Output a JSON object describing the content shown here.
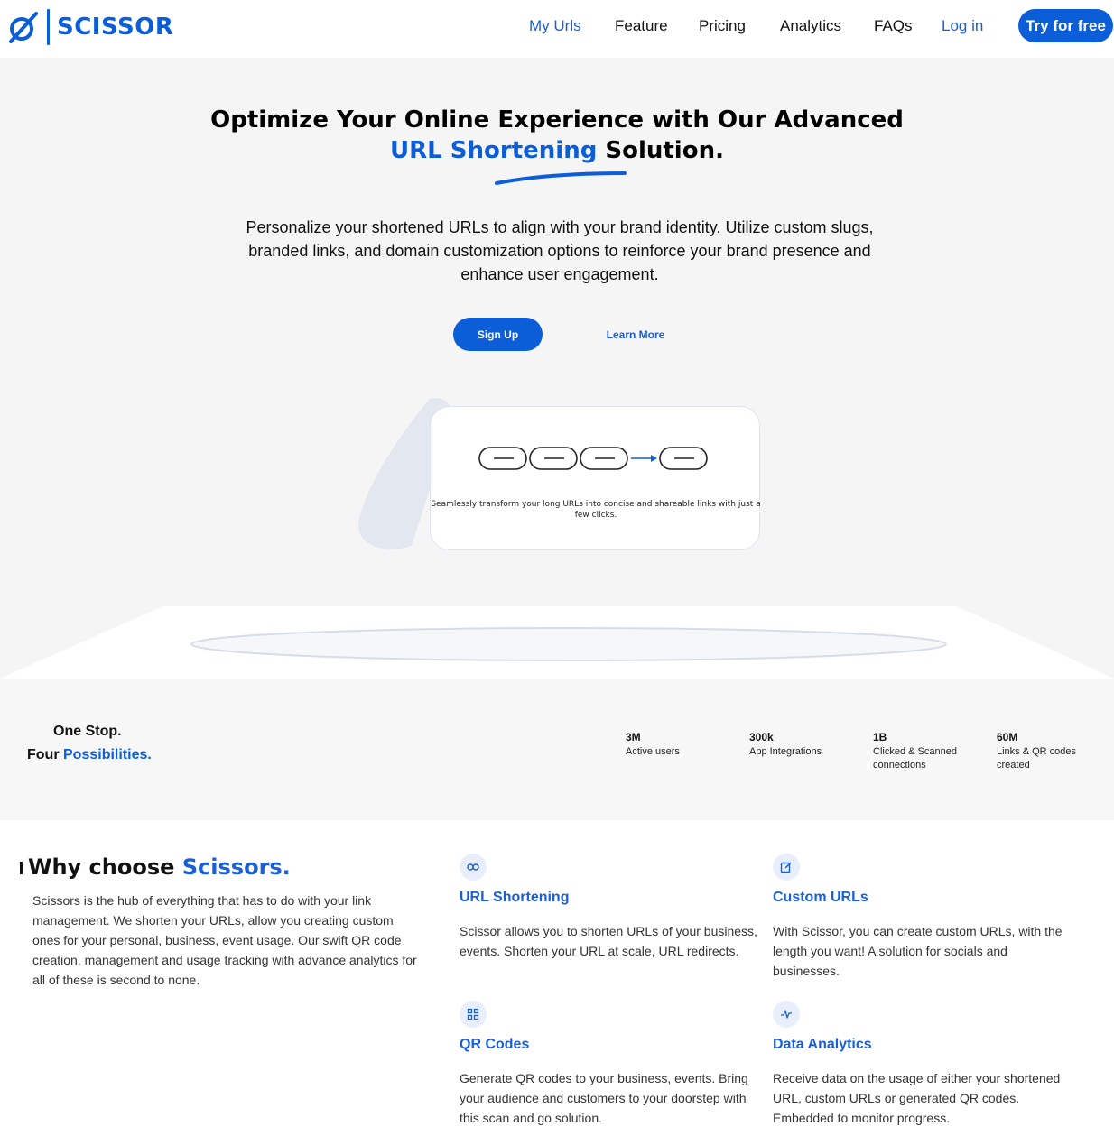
{
  "brand": {
    "name": "SCISSOR",
    "color": "#0b5ed7"
  },
  "nav": {
    "links": [
      {
        "label": "My Urls",
        "active": true
      },
      {
        "label": "Feature"
      },
      {
        "label": "Pricing"
      },
      {
        "label": "Analytics"
      },
      {
        "label": "FAQs"
      },
      {
        "label": "Log in",
        "active": true
      }
    ],
    "cta": "Try for free"
  },
  "hero": {
    "title_line1": "Optimize Your Online Experience with Our Advanced",
    "title_highlight": "URL Shortening",
    "title_end": " Solution.",
    "description": "Personalize your shortened URLs to align with your brand identity. Utilize custom slugs, branded links, and domain customization options to reinforce your brand presence and enhance user engagement.",
    "signup_label": "Sign Up",
    "learn_more_label": "Learn More",
    "card_caption": "Seamlessly transform your long URLs into concise and shareable links with just a few clicks."
  },
  "stats": {
    "heading_line1": "One Stop.",
    "heading_line2_plain": "Four ",
    "heading_line2_highlight": "Possibilities.",
    "items": [
      {
        "value": "3M",
        "label": "Active users"
      },
      {
        "value": "300k",
        "label": "App Integrations"
      },
      {
        "value": "1B",
        "label": "Clicked & Scanned connections"
      },
      {
        "value": "60M",
        "label": "Links & QR codes created"
      }
    ]
  },
  "why": {
    "title_plain": "Why choose ",
    "title_highlight": "Scissors.",
    "description": "Scissors is the hub of everything that has to do with your link management. We shorten your URLs, allow you creating custom ones for your personal, business, event usage. Our swift QR code creation, management and usage tracking with advance analytics for all of these is second to none.",
    "features": [
      {
        "icon": "link-icon",
        "title": "URL Shortening",
        "text": "Scissor allows you to shorten URLs of your business, events. Shorten your URL at scale, URL redirects."
      },
      {
        "icon": "edit-icon",
        "title": "Custom URLs",
        "text": "With Scissor, you can create custom URLs, with the length you want! A solution for socials and businesses."
      },
      {
        "icon": "qr-code-icon",
        "title": "QR Codes",
        "text": "Generate QR codes to your business, events. Bring your audience and customers to your doorstep with this scan and go solution."
      },
      {
        "icon": "activity-icon",
        "title": "Data Analytics",
        "text": "Receive data on the usage of either your shortened URL, custom URLs or generated QR codes. Embedded to monitor progress."
      }
    ]
  }
}
